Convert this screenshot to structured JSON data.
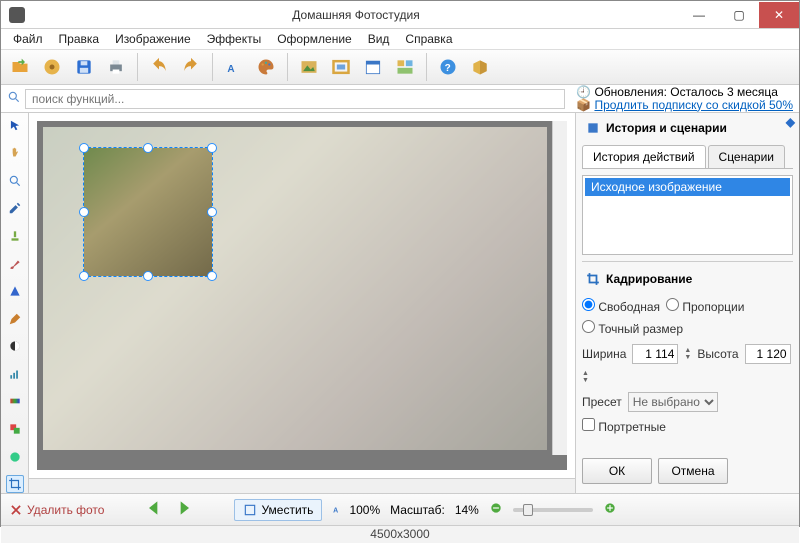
{
  "window": {
    "title": "Домашняя Фотостудия"
  },
  "menu": [
    "Файл",
    "Правка",
    "Изображение",
    "Эффекты",
    "Оформление",
    "Вид",
    "Справка"
  ],
  "search": {
    "placeholder": "поиск функций..."
  },
  "updates": {
    "line1": "Обновления: Осталось  3 месяца",
    "line2": "Продлить подписку со скидкой 50%"
  },
  "left_tools": [
    "pointer",
    "hand",
    "zoom",
    "eyedropper",
    "stamp",
    "brush",
    "bucket",
    "pen",
    "contrast",
    "shapes",
    "gradient",
    "layers",
    "crop-active"
  ],
  "history_panel": {
    "title": "История и сценарии",
    "tab_history": "История действий",
    "tab_scenario": "Сценарии",
    "items": [
      "Исходное изображение"
    ]
  },
  "crop_panel": {
    "title": "Кадрирование",
    "mode_free": "Свободная",
    "mode_prop": "Пропорции",
    "mode_exact": "Точный размер",
    "width_label": "Ширина",
    "width_value": "1 114",
    "height_label": "Высота",
    "height_value": "1 120",
    "preset_label": "Пресет",
    "preset_value": "Не выбрано",
    "portrait_label": "Портретные",
    "ok": "ОК",
    "cancel": "Отмена"
  },
  "bottom": {
    "delete_photo": "Удалить фото",
    "fit": "Уместить",
    "zoom100": "100%",
    "scale_label": "Масштаб:",
    "scale_value": "14%"
  },
  "status": {
    "dimensions": "4500x3000"
  }
}
